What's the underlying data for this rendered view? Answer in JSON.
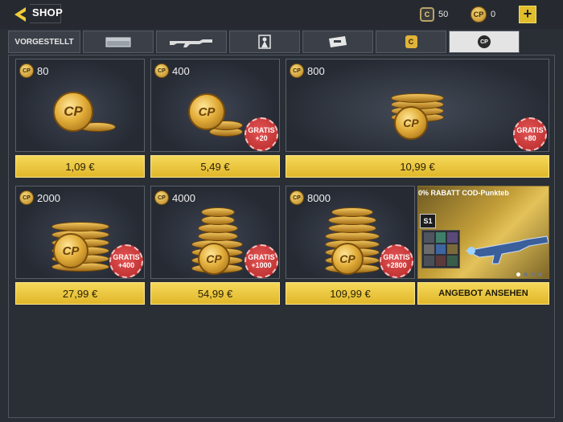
{
  "header": {
    "title": "SHOP",
    "cod_points": "50",
    "cp_balance": "0",
    "plus_label": "+"
  },
  "tabs": [
    {
      "label": "VORGESTELLT",
      "icon": "featured"
    },
    {
      "label": "",
      "icon": "crate-icon"
    },
    {
      "label": "",
      "icon": "rifle-icon"
    },
    {
      "label": "",
      "icon": "character-icon"
    },
    {
      "label": "",
      "icon": "ticket-icon"
    },
    {
      "label": "C",
      "icon": "cod-currency-icon"
    },
    {
      "label": "CP",
      "icon": "cp-currency-icon"
    }
  ],
  "cards": [
    {
      "amount": "80",
      "price": "1,09 €",
      "bonus": ""
    },
    {
      "amount": "400",
      "price": "5,49 €",
      "bonus_line1": "GRATIS",
      "bonus_line2": "+20"
    },
    {
      "amount": "800",
      "price": "10,99 €",
      "bonus_line1": "GRATIS",
      "bonus_line2": "+80"
    },
    {
      "amount": "2000",
      "price": "27,99 €",
      "bonus_line1": "GRATIS",
      "bonus_line2": "+400"
    },
    {
      "amount": "4000",
      "price": "54,99 €",
      "bonus_line1": "GRATIS",
      "bonus_line2": "+1000"
    },
    {
      "amount": "8000",
      "price": "109,99 €",
      "bonus_line1": "GRATIS",
      "bonus_line2": "+2800"
    }
  ],
  "promo": {
    "title": "0% RABATT        COD-Punkteb",
    "button": "ANGEBOT ANSEHEN",
    "badge": "S1"
  },
  "colors": {
    "accent": "#e1b72a",
    "bonus": "#c83a3a",
    "background": "#2a2f36"
  }
}
